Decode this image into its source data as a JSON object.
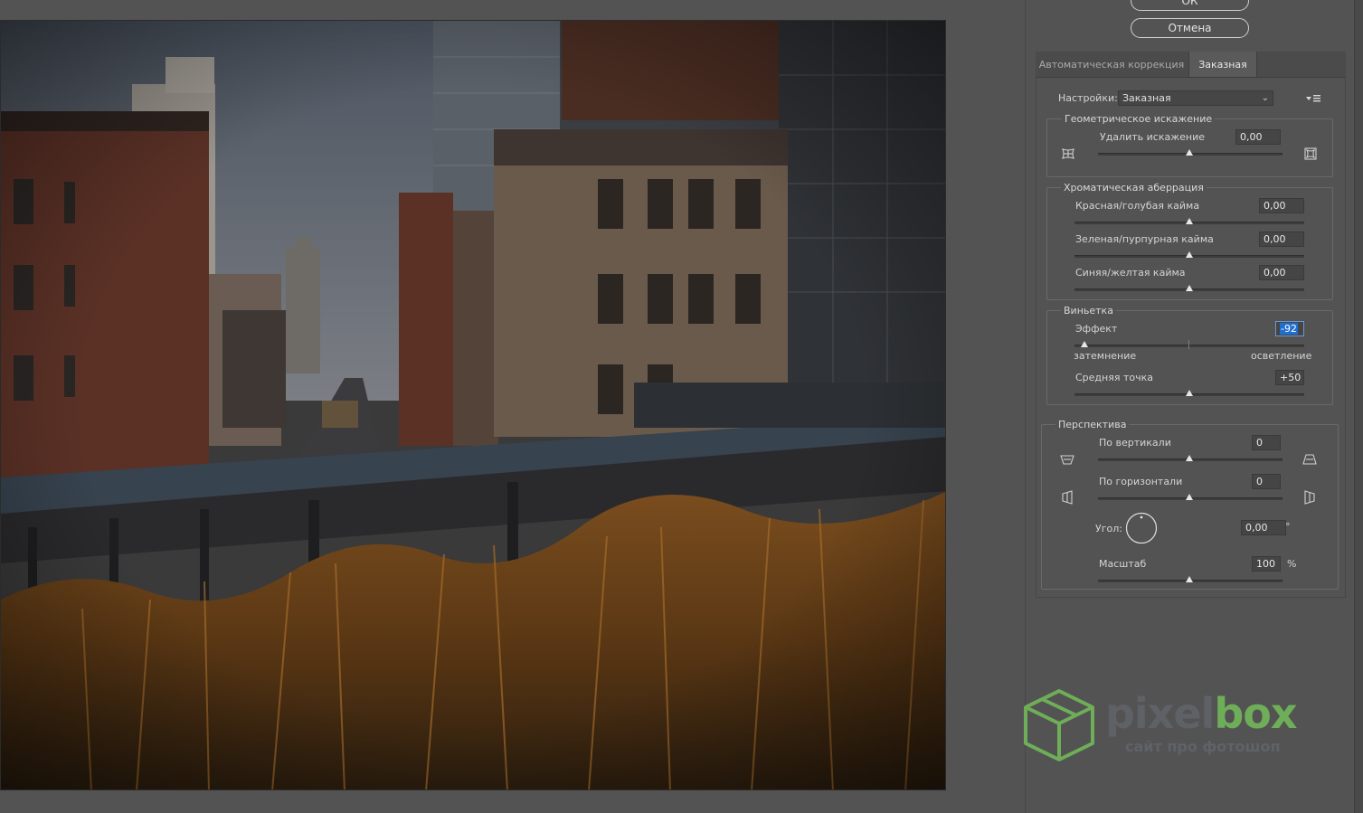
{
  "dialog": {
    "ok_label": "ОК",
    "cancel_label": "Отмена"
  },
  "tabs": [
    {
      "label": "Автоматическая коррекция",
      "active": false
    },
    {
      "label": "Заказная",
      "active": true
    }
  ],
  "settings": {
    "label": "Настройки:",
    "value": "Заказная"
  },
  "geometric": {
    "title": "Геометрическое искажение",
    "remove_label": "Удалить искажение",
    "remove_value": "0,00"
  },
  "chromatic": {
    "title": "Хроматическая аберрация",
    "items": [
      {
        "label": "Красная/голубая кайма",
        "value": "0,00"
      },
      {
        "label": "Зеленая/пурпурная кайма",
        "value": "0,00"
      },
      {
        "label": "Синяя/желтая кайма",
        "value": "0,00"
      }
    ]
  },
  "vignette": {
    "title": "Виньетка",
    "effect_label": "Эффект",
    "effect_value": "-92",
    "darken_label": "затемнение",
    "lighten_label": "осветление",
    "midpoint_label": "Средняя точка",
    "midpoint_value": "+50"
  },
  "perspective": {
    "title": "Перспектива",
    "vertical_label": "По вертикали",
    "vertical_value": "0",
    "horizontal_label": "По горизонтали",
    "horizontal_value": "0",
    "angle_label": "Угол:",
    "angle_value": "0,00",
    "angle_unit": "°",
    "scale_label": "Масштаб",
    "scale_value": "100",
    "scale_unit": "%"
  },
  "watermark": {
    "brand_part1": "pixel",
    "brand_part2": "box",
    "subtitle": "сайт про фотошоп"
  },
  "colors": {
    "ui_background": "#535353",
    "selection": "#1f6fd1",
    "brand_green": "#6fae58"
  }
}
